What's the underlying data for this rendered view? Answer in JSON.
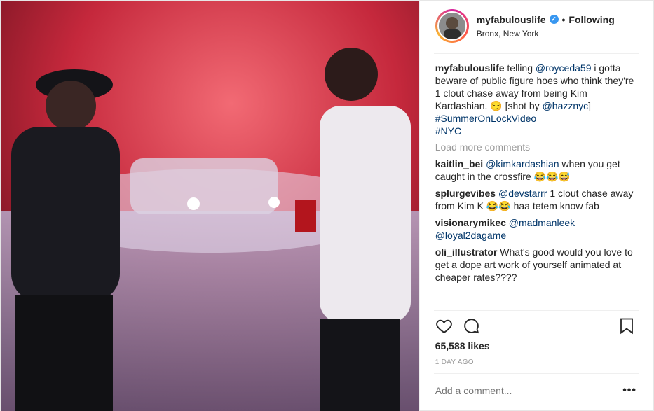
{
  "post": {
    "username": "myfabulouslife",
    "verified_mark": "✓",
    "separator": "•",
    "follow_status": "Following",
    "location": "Bronx, New York",
    "photo_icon": "photo-image"
  },
  "caption": {
    "username": "myfabulouslife",
    "text_1": "telling",
    "mention_1": "@royceda59",
    "text_2": "i gotta beware of public figure hoes who think they're 1 clout chase away from being Kim Kardashian. 😏 [shot by",
    "mention_2": "@hazznyc",
    "text_3": "]",
    "hashtag_1": "#SummerOnLockVideo",
    "hashtag_2": "#NYC"
  },
  "load_more": "Load more comments",
  "comments": [
    {
      "user": "kaitlin_bei",
      "mention": "@kimkardashian",
      "text": "when you get caught in the crossfire 😂😂😅"
    },
    {
      "user": "splurgevibes",
      "mention": "@devstarrr",
      "text": "1 clout chase away from Kim K 😂😂 haa tetem know fab"
    },
    {
      "user": "visionarymikec",
      "mention": "@madmanleek",
      "mention2": "@loyal2dagame",
      "text": ""
    },
    {
      "user": "oli_illustrator",
      "mention": "",
      "text": "What's good would you love to get a dope art work of yourself animated at cheaper rates????"
    }
  ],
  "icons": {
    "like": "heart-icon",
    "comment": "comment-icon",
    "save": "bookmark-icon",
    "more": "more-options-icon"
  },
  "likes": "65,588 likes",
  "timestamp": "1 DAY AGO",
  "add_comment_placeholder": "Add a comment...",
  "more_options": "•••"
}
